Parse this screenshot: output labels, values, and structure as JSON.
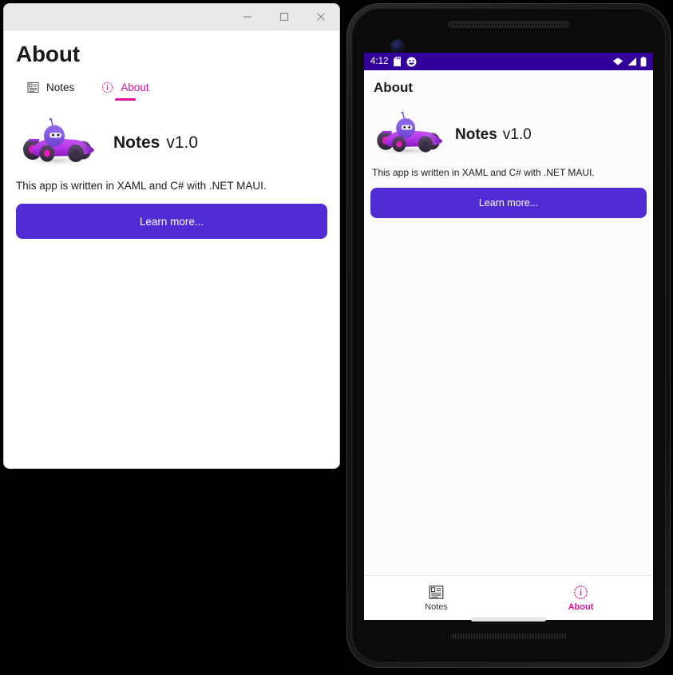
{
  "colors": {
    "accent_magenta": "#e0119d",
    "button_purple": "#512BD4",
    "status_bar_purple": "#32009b",
    "window_titlebar": "#e9e9e9",
    "text": "#1b1b1b"
  },
  "desktop_window": {
    "titlebar": {
      "minimize_label": "Minimize",
      "maximize_label": "Maximize",
      "close_label": "Close",
      "minimize_icon": "minimize-icon",
      "maximize_icon": "maximize-icon",
      "close_icon": "close-icon"
    },
    "page_title": "About",
    "tabs": [
      {
        "label": "Notes",
        "icon": "notes-list-icon",
        "active": false
      },
      {
        "label": "About",
        "icon": "info-circle-icon",
        "active": true
      }
    ],
    "about": {
      "logo_icon": "dotnet-bot-racecar-logo",
      "app_name": "Notes",
      "version": "v1.0",
      "description": "This app is written in XAML and C# with .NET MAUI.",
      "cta_label": "Learn more..."
    }
  },
  "phone": {
    "status_bar": {
      "time": "4:12",
      "icons_left": [
        "sd-card-icon",
        "smiley-face-icon"
      ],
      "icons_right": [
        "wifi-icon",
        "cell-signal-icon",
        "battery-icon"
      ]
    },
    "app_bar": {
      "title": "About"
    },
    "about": {
      "logo_icon": "dotnet-bot-racecar-logo",
      "app_name": "Notes",
      "version": "v1.0",
      "description": "This app is written in XAML and C# with .NET MAUI.",
      "cta_label": "Learn more..."
    },
    "tabs": [
      {
        "label": "Notes",
        "icon": "notes-list-icon",
        "active": false
      },
      {
        "label": "About",
        "icon": "info-circle-icon",
        "active": true
      }
    ],
    "hardware": {
      "ear_speaker": "ear-speaker-grille",
      "front_camera": "front-camera",
      "bottom_speaker": "bottom-speaker-grille",
      "home_indicator": "home-indicator"
    }
  }
}
